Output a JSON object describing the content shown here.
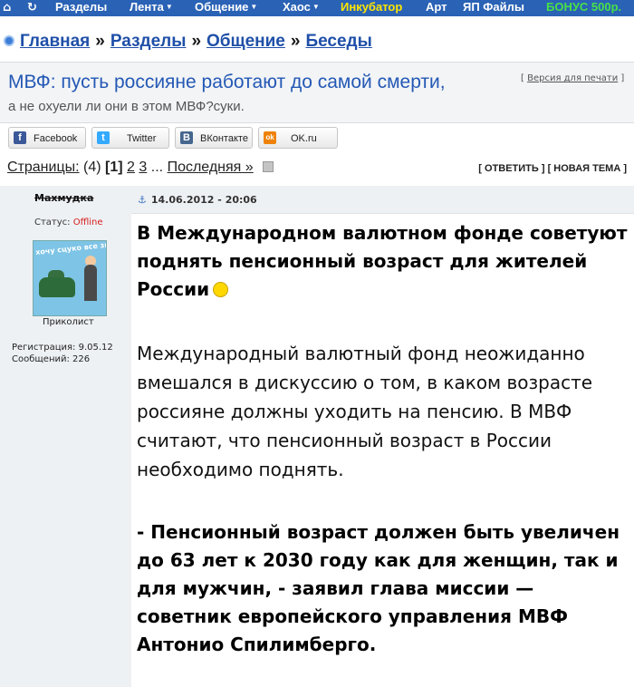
{
  "topbar": {
    "home_icon": "home-icon",
    "refresh_icon": "refresh-icon",
    "items": [
      {
        "label": "Разделы",
        "dropdown": false
      },
      {
        "label": "Лента",
        "dropdown": true
      },
      {
        "label": "Общение",
        "dropdown": true
      },
      {
        "label": "Хаос",
        "dropdown": true
      },
      {
        "label": "Инкубатор",
        "dropdown": false,
        "color": "#ffe600"
      },
      {
        "label": "Арт",
        "dropdown": false
      },
      {
        "label": "ЯП Файлы",
        "dropdown": false
      },
      {
        "label": "БОНУС 500р.",
        "dropdown": false,
        "color": "#48e048"
      }
    ],
    "background": "#2a62b5"
  },
  "breadcrumb": {
    "items": [
      "Главная",
      "Разделы",
      "Общение",
      "Беседы"
    ],
    "separator": "»"
  },
  "topic": {
    "title": "МВФ: пусть россияне работают до самой смерти,",
    "subtitle": "а не охуели ли они в этом МВФ?суки.",
    "print_link": "Версия для печати",
    "title_color": "#2458b5"
  },
  "share": [
    {
      "label": "Facebook",
      "icon": "facebook-icon",
      "color": "#3b5998",
      "glyph": "f"
    },
    {
      "label": "Twitter",
      "icon": "twitter-icon",
      "color": "#33aaff",
      "glyph": "t"
    },
    {
      "label": "ВКонтакте",
      "icon": "vk-icon",
      "color": "#45668e",
      "glyph": "B"
    },
    {
      "label": "OK.ru",
      "icon": "odnoklassniki-icon",
      "color": "#ee8208",
      "glyph": "ok"
    }
  ],
  "pagination": {
    "label": "Страницы:",
    "count": "(4)",
    "current": "[1]",
    "pages": [
      "2",
      "3"
    ],
    "ellipsis": "...",
    "last": "Последняя »"
  },
  "actions": {
    "reply": "ОТВЕТИТЬ",
    "new_topic": "НОВАЯ ТЕМА"
  },
  "post": {
    "author": "Махмудка",
    "status_label": "Статус:",
    "status_value": "Offline",
    "avatar_text": "хочу  сцуко  все  знать",
    "rank": "Приколист",
    "registration": "Регистрация: 9.05.12",
    "messages": "Сообщений: 226",
    "date": "14.06.2012 - 20:06",
    "heading": "В Международном валютном фонде советуют поднять пенсионный возраст для жителей России",
    "paragraph": "Международный валютный фонд неожиданно вмешался в дискуссию о том, в каком возрасте россияне должны уходить на пенсию. В МВФ считают, что пенсионный возраст в России необходимо поднять.",
    "quote": "- Пенсионный возраст должен быть увеличен до 63 лет к 2030 году как для женщин, так и для мужчин, - заявил глава миссии — советник европейского управления МВФ Антонио Спилимберго."
  }
}
